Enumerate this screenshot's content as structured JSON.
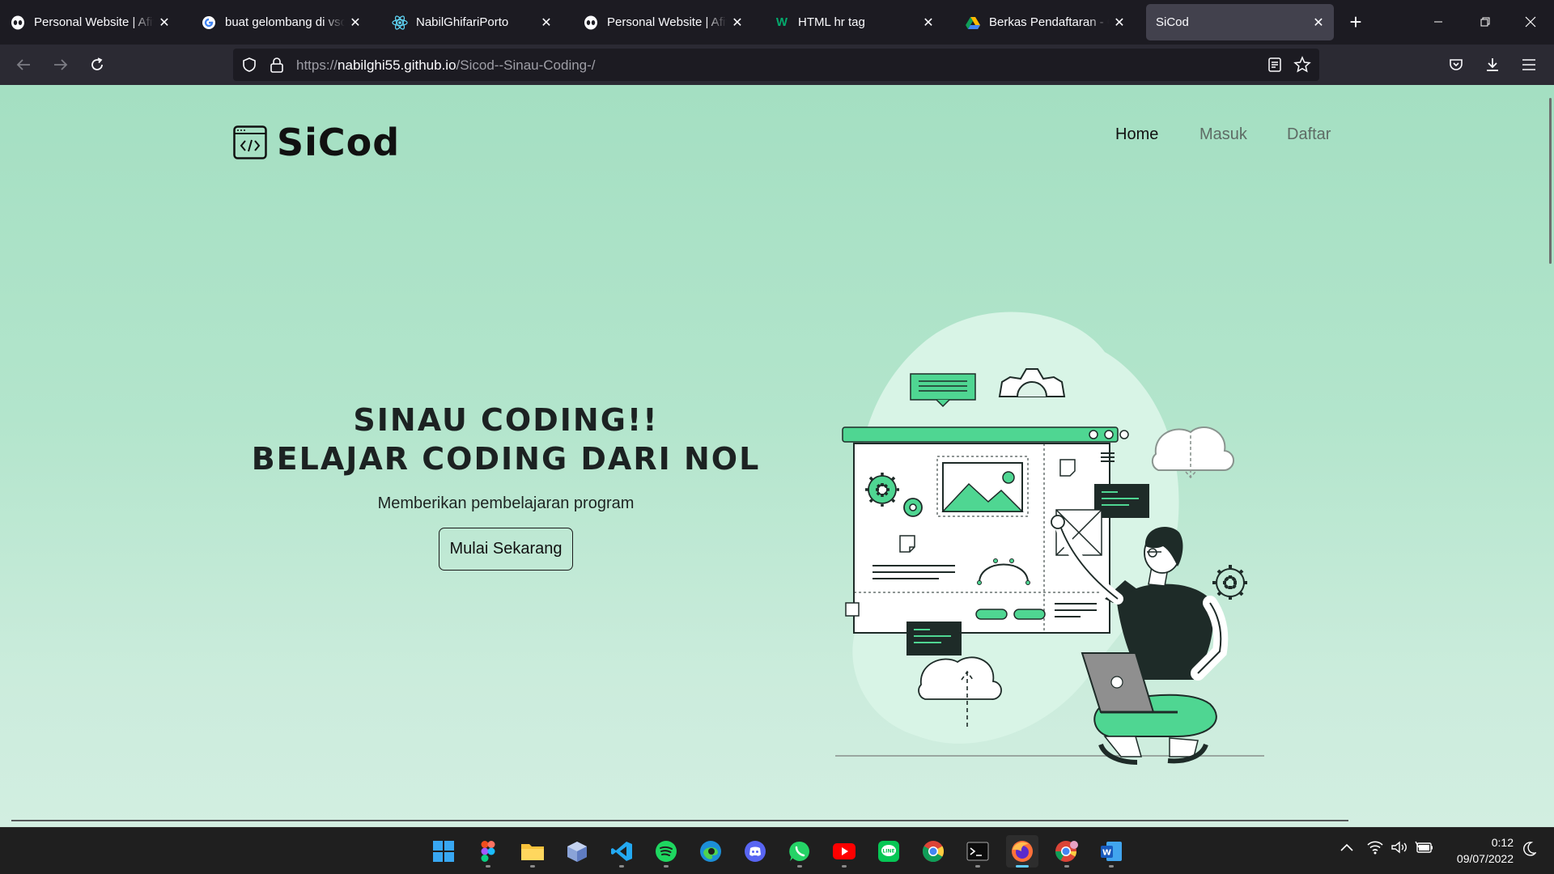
{
  "browser": {
    "tabs": [
      {
        "title": "Personal Website | Afif Hidayat",
        "icon": "alien-icon"
      },
      {
        "title": "buat gelombang di vscode",
        "icon": "google-icon"
      },
      {
        "title": "NabilGhifariPorto",
        "icon": "react-icon"
      },
      {
        "title": "Personal Website | Afif Hidayat",
        "icon": "alien-icon"
      },
      {
        "title": "HTML hr tag",
        "icon": "w3-icon"
      },
      {
        "title": "Berkas Pendaftaran - Google Drive",
        "icon": "drive-icon"
      },
      {
        "title": "SiCod",
        "icon": "none"
      }
    ],
    "url_prefix": "https://",
    "url_host": "nabilghi55.github.io",
    "url_path": "/Sicod--Sinau-Coding-/"
  },
  "site": {
    "brand": "SiCod",
    "nav": [
      "Home",
      "Masuk",
      "Daftar"
    ],
    "hero_line1": "Sinau Coding!!",
    "hero_line2": "Belajar Coding Dari Nol",
    "hero_sub": "Memberikan pembelajaran program",
    "cta": "Mulai Sekarang",
    "accent_color": "#4fd692"
  },
  "taskbar": {
    "apps": [
      "windows-start",
      "figma",
      "file-explorer",
      "virtualbox",
      "vscode",
      "spotify",
      "edge",
      "discord",
      "whatsapp",
      "youtube",
      "line",
      "chrome",
      "terminal",
      "firefox",
      "chrome-profile",
      "word"
    ],
    "time": "0:12",
    "date": "09/07/2022"
  }
}
